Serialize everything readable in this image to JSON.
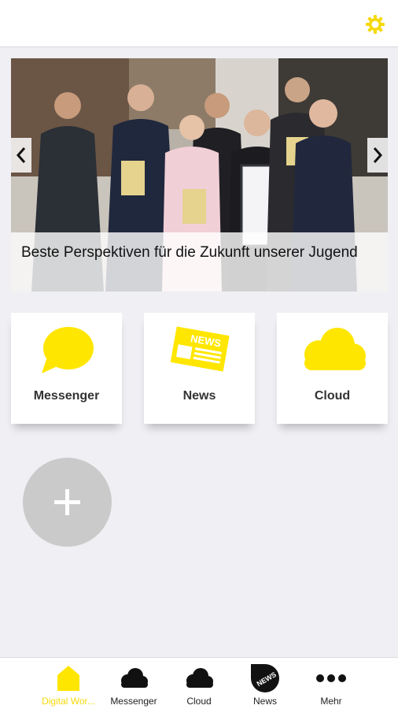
{
  "header": {
    "settings_icon": "gear-icon",
    "accent": "#f5d90a"
  },
  "carousel": {
    "caption": "Beste Perspektiven für die Zukunft unserer Jugend",
    "prev_icon": "chevron-left-icon",
    "next_icon": "chevron-right-icon"
  },
  "tiles": [
    {
      "label": "Messenger",
      "icon": "chat-bubble-icon"
    },
    {
      "label": "News",
      "icon": "newspaper-icon"
    },
    {
      "label": "Cloud",
      "icon": "cloud-icon"
    }
  ],
  "add_button": {
    "icon": "plus-icon"
  },
  "tabbar": {
    "items": [
      {
        "label": "Digital Wor...",
        "icon": "home-icon",
        "active": true
      },
      {
        "label": "Messenger",
        "icon": "cloud-icon",
        "active": false
      },
      {
        "label": "Cloud",
        "icon": "cloud-icon",
        "active": false
      },
      {
        "label": "News",
        "icon": "news-badge-icon",
        "active": false
      },
      {
        "label": "Mehr",
        "icon": "more-dots-icon",
        "active": false
      }
    ]
  }
}
